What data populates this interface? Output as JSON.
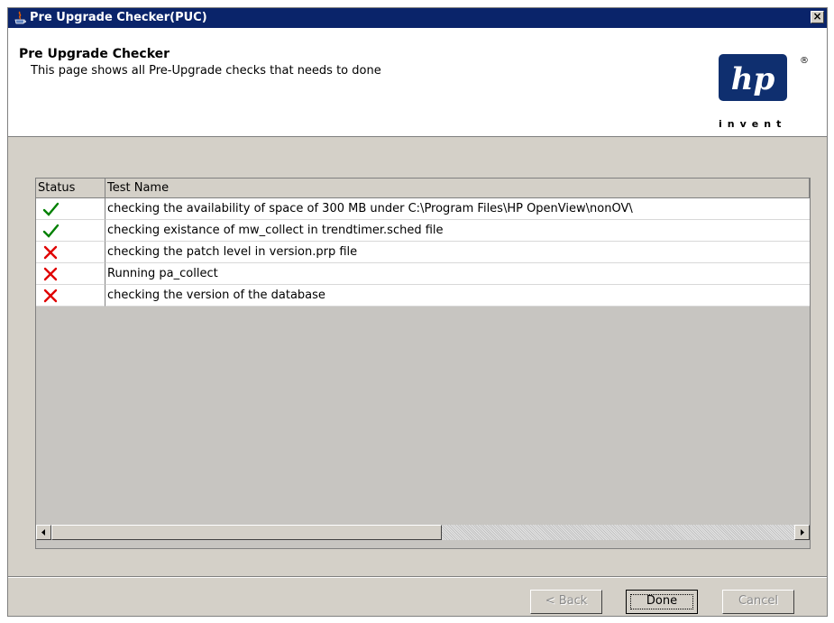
{
  "window": {
    "title": "Pre Upgrade Checker(PUC)",
    "close_glyph": "×",
    "close_icon": "close-icon",
    "app_icon": "java-app-icon"
  },
  "header": {
    "title": "Pre Upgrade Checker",
    "subtitle": "This page shows all Pre-Upgrade checks that needs to done",
    "logo": {
      "brand": "hp",
      "tagline": "invent",
      "registered_mark": "®",
      "color": "#0f2f6f"
    }
  },
  "table": {
    "columns": [
      "Status",
      "Test Name"
    ],
    "rows": [
      {
        "status": "pass",
        "status_icon": "check-icon",
        "name": "checking the availability of space of 300 MB under C:\\Program Files\\HP OpenView\\nonOV\\"
      },
      {
        "status": "pass",
        "status_icon": "check-icon",
        "name": "checking existance of mw_collect in trendtimer.sched file"
      },
      {
        "status": "fail",
        "status_icon": "cross-icon",
        "name": "checking the patch level in version.prp file"
      },
      {
        "status": "fail",
        "status_icon": "cross-icon",
        "name": "Running pa_collect"
      },
      {
        "status": "fail",
        "status_icon": "cross-icon",
        "name": "checking the version of the database"
      }
    ],
    "status_colors": {
      "pass": "#008000",
      "fail": "#e00000"
    }
  },
  "buttons": {
    "back": "< Back",
    "done": "Done",
    "cancel": "Cancel",
    "back_enabled": false,
    "done_enabled": true,
    "cancel_enabled": false
  }
}
